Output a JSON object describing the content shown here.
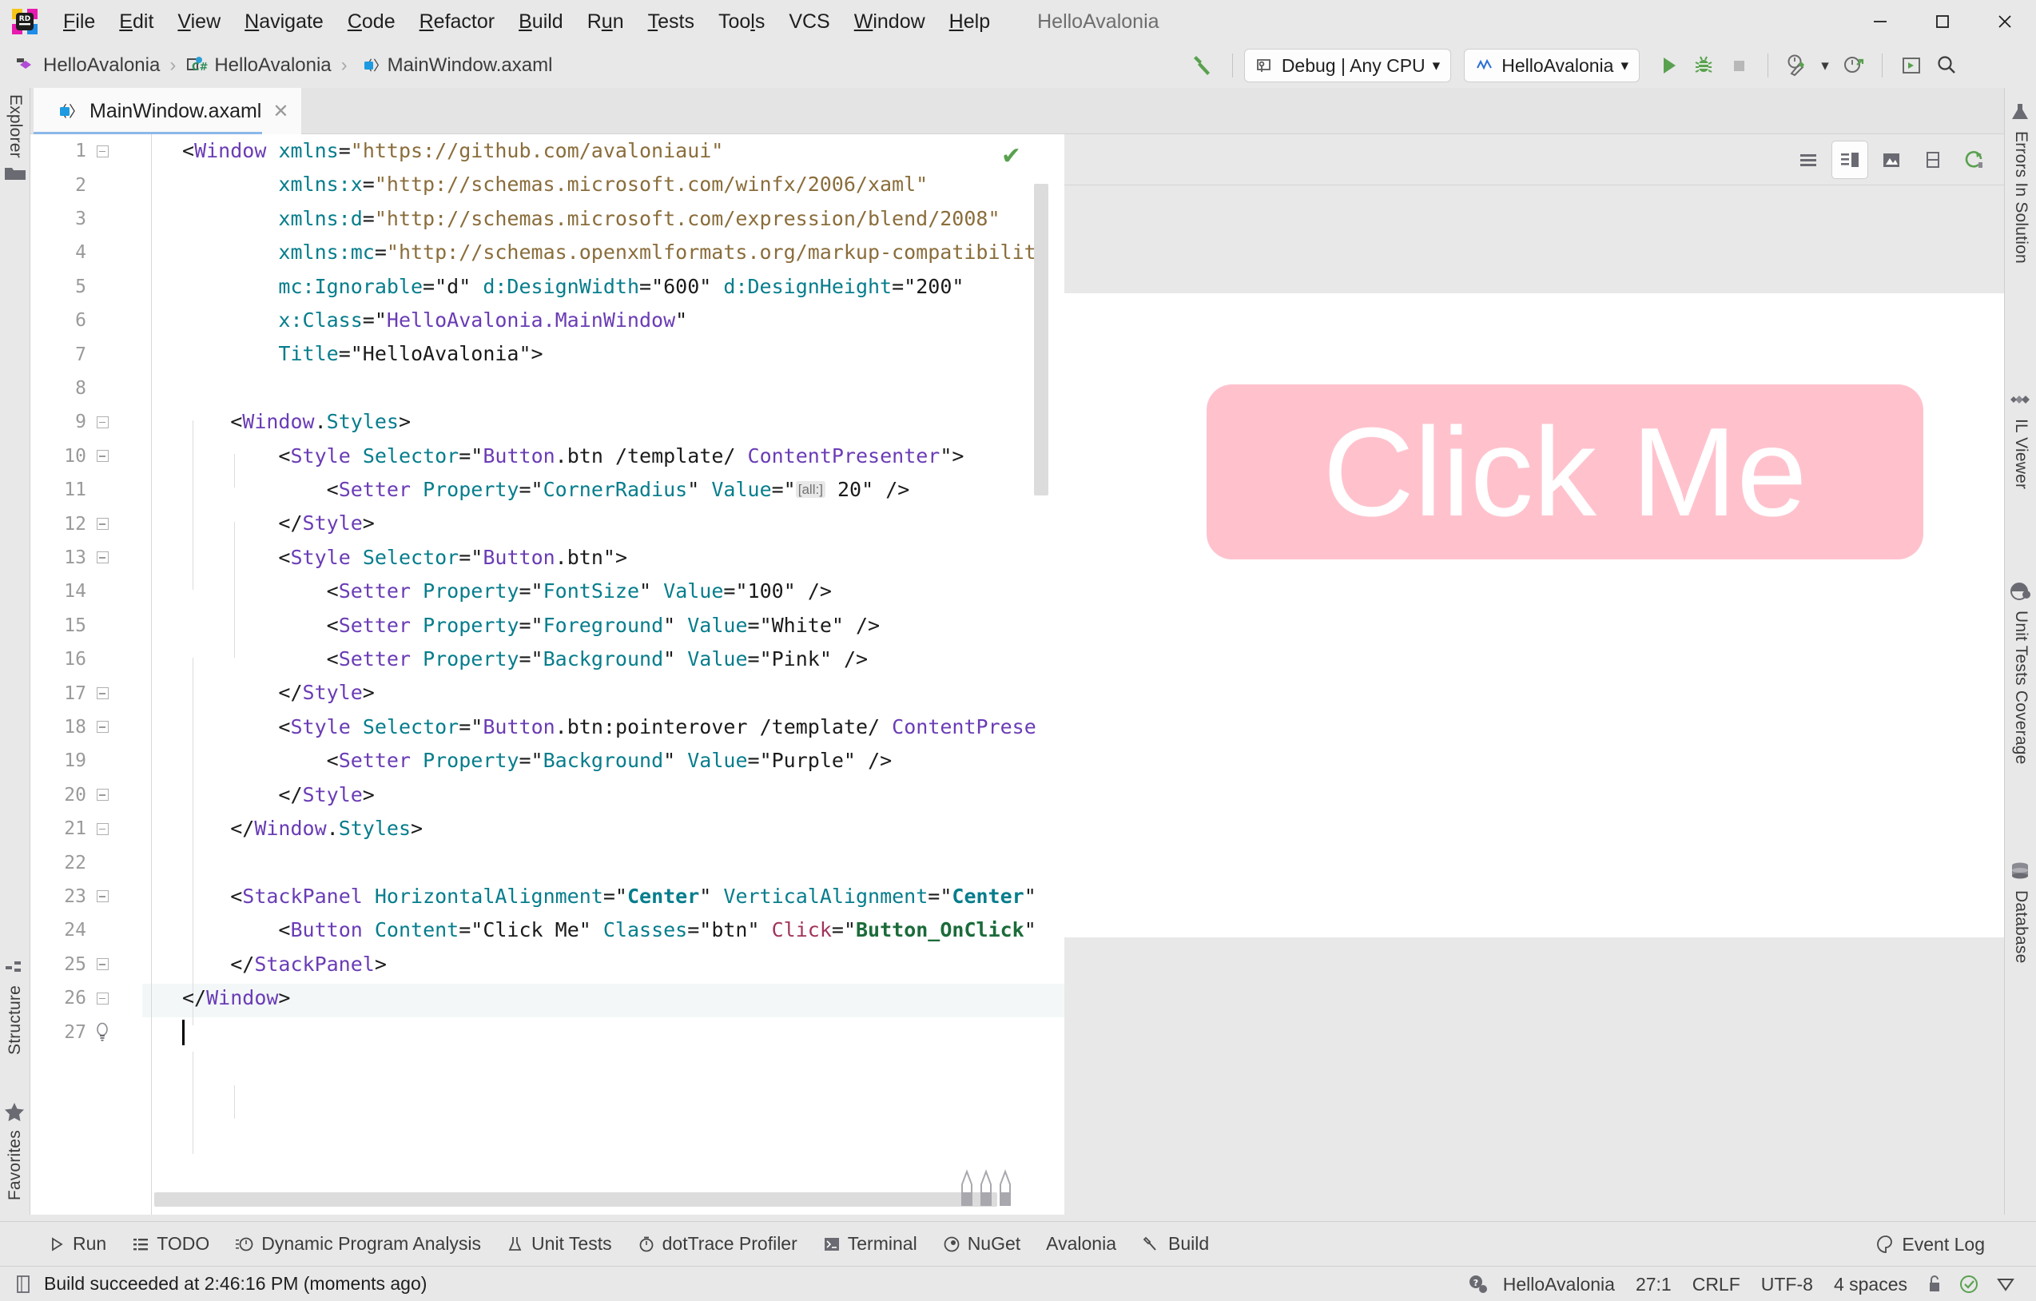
{
  "window": {
    "title": "HelloAvalonia",
    "controls": {
      "minimize": "minimize-button",
      "maximize": "maximize-button",
      "close": "close-button"
    }
  },
  "menu": {
    "items": [
      {
        "label": "File",
        "mnemonic": "F"
      },
      {
        "label": "Edit",
        "mnemonic": "E"
      },
      {
        "label": "View",
        "mnemonic": "V"
      },
      {
        "label": "Navigate",
        "mnemonic": "N"
      },
      {
        "label": "Code",
        "mnemonic": "C"
      },
      {
        "label": "Refactor",
        "mnemonic": "R"
      },
      {
        "label": "Build",
        "mnemonic": "B"
      },
      {
        "label": "Run",
        "mnemonic": "u"
      },
      {
        "label": "Tests",
        "mnemonic": "T"
      },
      {
        "label": "Tools",
        "mnemonic": "l"
      },
      {
        "label": "VCS",
        "mnemonic": ""
      },
      {
        "label": "Window",
        "mnemonic": "W"
      },
      {
        "label": "Help",
        "mnemonic": "H"
      }
    ]
  },
  "breadcrumb": {
    "items": [
      {
        "label": "HelloAvalonia",
        "icon": "solution-icon"
      },
      {
        "label": "HelloAvalonia",
        "icon": "csharp-project-icon"
      },
      {
        "label": "MainWindow.axaml",
        "icon": "xaml-file-icon"
      }
    ],
    "separator": "›"
  },
  "toolbar": {
    "build_icon": "hammer-icon",
    "configuration": "Debug | Any CPU",
    "run_config": "HelloAvalonia",
    "dropdown_caret": "▾",
    "actions": [
      {
        "name": "run-button",
        "icon": "play-icon"
      },
      {
        "name": "debug-button",
        "icon": "bug-icon"
      },
      {
        "name": "stop-button",
        "icon": "stop-icon"
      },
      {
        "name": "coverage-button",
        "icon": "coverage-icon"
      },
      {
        "name": "coverage-dropdown",
        "icon": "chevron-down-icon"
      },
      {
        "name": "profile-button",
        "icon": "profiler-icon"
      },
      {
        "name": "run-widget-button",
        "icon": "run-anything-icon"
      },
      {
        "name": "search-everywhere-button",
        "icon": "search-icon"
      }
    ]
  },
  "left_tool_strip": {
    "top": [
      {
        "label": "Explorer",
        "icon": "folder-icon"
      }
    ],
    "bottom": [
      {
        "label": "Structure",
        "icon": "structure-icon"
      },
      {
        "label": "Favorites",
        "icon": "star-icon"
      }
    ]
  },
  "right_tool_strip": {
    "items": [
      {
        "label": "Errors In Solution",
        "icon": "errors-icon"
      },
      {
        "label": "IL Viewer",
        "icon": "il-viewer-icon"
      },
      {
        "label": "Unit Tests Coverage",
        "icon": "coverage-icon"
      },
      {
        "label": "Database",
        "icon": "database-icon"
      }
    ]
  },
  "editor": {
    "tab": {
      "label": "MainWindow.axaml",
      "icon": "xaml-file-icon",
      "close": "✕"
    },
    "inspection_status": "✔",
    "indent_guide_columns": [
      1,
      2
    ],
    "lines": [
      {
        "n": 1,
        "fold": true,
        "indent": 0
      },
      {
        "n": 2,
        "fold": false,
        "indent": 0
      },
      {
        "n": 3,
        "fold": false,
        "indent": 0
      },
      {
        "n": 4,
        "fold": false,
        "indent": 0
      },
      {
        "n": 5,
        "fold": false,
        "indent": 0
      },
      {
        "n": 6,
        "fold": false,
        "indent": 0
      },
      {
        "n": 7,
        "fold": false,
        "indent": 0
      },
      {
        "n": 8,
        "fold": false,
        "indent": 0
      },
      {
        "n": 9,
        "fold": true,
        "indent": 0
      },
      {
        "n": 10,
        "fold": true,
        "indent": 0
      },
      {
        "n": 11,
        "fold": false,
        "indent": 0
      },
      {
        "n": 12,
        "fold": true,
        "indent": 0
      },
      {
        "n": 13,
        "fold": true,
        "indent": 0
      },
      {
        "n": 14,
        "fold": false,
        "indent": 0
      },
      {
        "n": 15,
        "fold": false,
        "indent": 0
      },
      {
        "n": 16,
        "fold": false,
        "indent": 0
      },
      {
        "n": 17,
        "fold": true,
        "indent": 0
      },
      {
        "n": 18,
        "fold": true,
        "indent": 0
      },
      {
        "n": 19,
        "fold": false,
        "indent": 0
      },
      {
        "n": 20,
        "fold": true,
        "indent": 0
      },
      {
        "n": 21,
        "fold": true,
        "indent": 0
      },
      {
        "n": 22,
        "fold": false,
        "indent": 0
      },
      {
        "n": 23,
        "fold": true,
        "indent": 0
      },
      {
        "n": 24,
        "fold": false,
        "indent": 0
      },
      {
        "n": 25,
        "fold": true,
        "indent": 0
      },
      {
        "n": 26,
        "fold": true,
        "indent": 0
      },
      {
        "n": 27,
        "fold": false,
        "indent": 0,
        "intention_icon": "lightbulb-icon",
        "current": true
      }
    ],
    "code_text": [
      "<Window xmlns=\"https://github.com/avaloniaui\"",
      "        xmlns:x=\"http://schemas.microsoft.com/winfx/2006/xaml\"",
      "        xmlns:d=\"http://schemas.microsoft.com/expression/blend/2008\"",
      "        xmlns:mc=\"http://schemas.openxmlformats.org/markup-compatibilit",
      "        mc:Ignorable=\"d\" d:DesignWidth=\"600\" d:DesignHeight=\"200\"",
      "        x:Class=\"HelloAvalonia.MainWindow\"",
      "        Title=\"HelloAvalonia\">",
      "",
      "    <Window.Styles>",
      "        <Style Selector=\"Button.btn /template/ ContentPresenter\">",
      "            <Setter Property=\"CornerRadius\" Value=\"[all:] 20\" />",
      "        </Style>",
      "        <Style Selector=\"Button.btn\">",
      "            <Setter Property=\"FontSize\" Value=\"100\" />",
      "            <Setter Property=\"Foreground\" Value=\"White\" />",
      "            <Setter Property=\"Background\" Value=\"Pink\" />",
      "        </Style>",
      "        <Style Selector=\"Button.btn:pointerover /template/ ContentPrese",
      "            <Setter Property=\"Background\" Value=\"Purple\" />",
      "        </Style>",
      "    </Window.Styles>",
      "",
      "    <StackPanel HorizontalAlignment=\"Center\" VerticalAlignment=\"Center\"",
      "        <Button Content=\"Click Me\" Classes=\"btn\" Click=\"Button_OnClick\"",
      "    </StackPanel>",
      "</Window>",
      ""
    ],
    "inlay_hint": "[all:]"
  },
  "preview": {
    "toolbar_buttons": [
      {
        "name": "preview-list-view-button",
        "icon": "list-view-icon",
        "active": false
      },
      {
        "name": "preview-split-view-button",
        "icon": "split-view-icon",
        "active": true
      },
      {
        "name": "preview-design-view-button",
        "icon": "design-view-icon",
        "active": false
      },
      {
        "name": "preview-orientation-button",
        "icon": "split-horizontal-icon",
        "active": false
      },
      {
        "name": "preview-refresh-button",
        "icon": "refresh-icon",
        "active": false
      }
    ],
    "button_content": "Click Me",
    "button_background": "#ffc2cd",
    "button_foreground": "#ffffff",
    "button_corner_radius": "20"
  },
  "bottom_tool_window_bar": {
    "items": [
      {
        "label": "Run",
        "icon": "play-icon"
      },
      {
        "label": "TODO",
        "icon": "todo-icon"
      },
      {
        "label": "Dynamic Program Analysis",
        "icon": "dpa-icon"
      },
      {
        "label": "Unit Tests",
        "icon": "unit-tests-icon"
      },
      {
        "label": "dotTrace Profiler",
        "icon": "dottrace-icon"
      },
      {
        "label": "Terminal",
        "icon": "terminal-icon"
      },
      {
        "label": "NuGet",
        "icon": "nuget-icon"
      },
      {
        "label": "Avalonia",
        "icon": ""
      },
      {
        "label": "Build",
        "icon": "hammer-icon"
      }
    ],
    "event_log": {
      "label": "Event Log",
      "icon": "event-log-icon"
    }
  },
  "status_bar": {
    "message": "Build succeeded at 2:46:16 PM (moments ago)",
    "message_icon": "build-status-icon",
    "items": [
      {
        "label": "HelloAvalonia",
        "name": "status-solution"
      },
      {
        "label": "27:1",
        "name": "status-caret-position"
      },
      {
        "label": "CRLF",
        "name": "status-line-separator"
      },
      {
        "label": "UTF-8",
        "name": "status-encoding"
      },
      {
        "label": "4 spaces",
        "name": "status-indent"
      }
    ],
    "icons": [
      {
        "name": "lock-icon"
      },
      {
        "name": "inspection-ok-icon"
      },
      {
        "name": "notifications-icon"
      }
    ]
  },
  "colors": {
    "chrome": "#e8e8e8",
    "editor_bg": "#ffffff",
    "accent_blue": "#8cb8e8",
    "green": "#59a14f",
    "tag": "#6a3cb5",
    "attribute": "#067d8c",
    "value_url": "#8a6d3b",
    "event": "#a1345c"
  }
}
